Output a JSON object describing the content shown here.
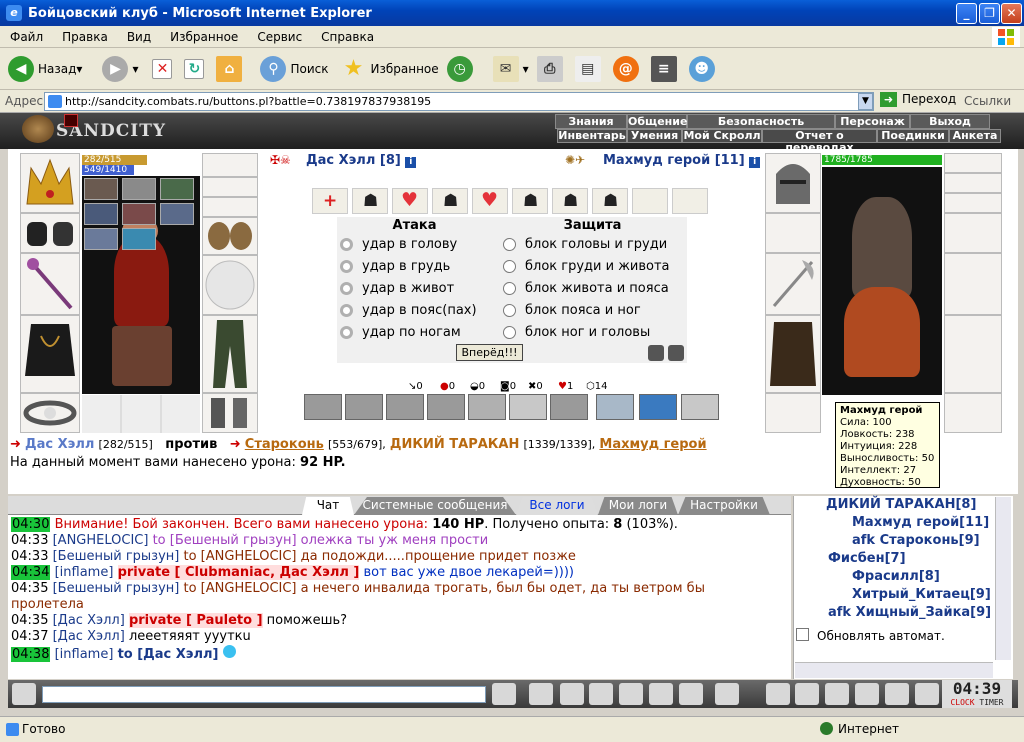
{
  "window": {
    "title": "Бойцовский клуб - Microsoft Internet Explorer"
  },
  "menu": [
    "Файл",
    "Правка",
    "Вид",
    "Избранное",
    "Сервис",
    "Справка"
  ],
  "toolbar": {
    "back": "Назад",
    "search": "Поиск",
    "favorites": "Избранное"
  },
  "address": {
    "label": "Адрес:",
    "url": "http://sandcity.combats.ru/buttons.pl?battle=0.738197837938195",
    "go": "Переход",
    "links": "Ссылки"
  },
  "game": {
    "logo": "SANDCITY",
    "nav_top": [
      "Знания",
      "Общение",
      "Безопасность",
      "Персонаж",
      "Выход"
    ],
    "nav_bottom": [
      "Инвентарь",
      "Умения",
      "Мой Скролл",
      "Отчет о переводах",
      "Поединки",
      "Анкета"
    ]
  },
  "player": {
    "name": "Дас Хэлл [8]",
    "hp": "282/515",
    "mana": "549/1410"
  },
  "enemy": {
    "name": "Махмуд герой [11]",
    "hp": "1785/1785"
  },
  "attack": {
    "title": "Атака",
    "items": [
      "удар в голову",
      "удар в грудь",
      "удар в живот",
      "удар в пояс(пах)",
      "удар по ногам"
    ]
  },
  "defense": {
    "title": "Защита",
    "items": [
      "блок головы и груди",
      "блок груди и живота",
      "блок живота и пояса",
      "блок пояса и ног",
      "блок ног и головы"
    ]
  },
  "forward_button": "Вперёд!!!",
  "counters": [
    "0",
    "0",
    "0",
    "0",
    "0",
    "1",
    "14"
  ],
  "battle_line": {
    "p1": "Дас Хэлл",
    "p1hp": "[282/515]",
    "vs": "против",
    "e1": "Староконь",
    "e1hp": "[553/679],",
    "e2": "ДИКИЙ ТАРАКАН",
    "e2hp": "[1339/1339],",
    "e3": "Махмуд герой"
  },
  "damage": {
    "text": "На данный момент вами нанесено урона:",
    "value": "92 HP."
  },
  "tooltip": {
    "name": "Махмуд герой",
    "lines": [
      "Сила: 100",
      "Ловкость: 238",
      "Интуиция: 228",
      "Выносливость: 50",
      "Интеллект: 27",
      "Духовность: 50"
    ]
  },
  "chat_tabs": [
    "Чат",
    "Системные сообщения",
    "Все логи",
    "Мои логи",
    "Настройки"
  ],
  "chat": [
    {
      "time": "04:30",
      "html_a": "Внимание! Бой закончен. Всего вами нанесено урона: ",
      "b": "140 HP",
      "c": ". Получено опыта: ",
      "d": "8",
      "e": " (103%)."
    },
    {
      "time": "04:33",
      "from": "[ANGHELOCIC]",
      "to": "to [Бешеный грызун]",
      "msg": " олежка ты уж меня прости"
    },
    {
      "time": "04:33",
      "from": "[Бешеный грызун]",
      "to": "to [ANGHELOCIC]",
      "msg": " да подожди.....прощение придет позже"
    },
    {
      "time": "04:34",
      "from": "[inflame]",
      "to": "private [ Clubmaniac, Дас Хэлл ]",
      "msg": " вот вас уже двое лекарей=))))"
    },
    {
      "time": "04:35",
      "from": "[Бешеный грызун]",
      "to": "to [ANGHELOCIC]",
      "msg": " а нечего инвалида трогать, был бы одет, да ты ветром бы"
    },
    {
      "cont": "пролетела"
    },
    {
      "time": "04:35",
      "from": "[Дас Хэлл]",
      "to": "private [ Pauleto ]",
      "msg": " поможешь?"
    },
    {
      "time": "04:37",
      "from": "[Дас Хэлл]",
      "msg": " лееетяяят уууткu"
    },
    {
      "time": "04:38",
      "from": "[inflame]",
      "to": "to [Дас Хэлл]",
      "msg": ""
    }
  ],
  "users": [
    "ДИКИЙ ТАРАКАН[8]",
    "Махмуд герой[11]",
    "afk Староконь[9]",
    "Фисбен[7]",
    "Фрасилл[8]",
    "Хитрый_Китаец[9]",
    "afk Хищный_Зайка[9]"
  ],
  "auto_refresh": "Обновлять автомат.",
  "clock": {
    "time": "04:39",
    "label1": "CLOCK",
    "label2": "TIMER"
  },
  "status": {
    "left": "Готово",
    "right": "Интернет"
  }
}
